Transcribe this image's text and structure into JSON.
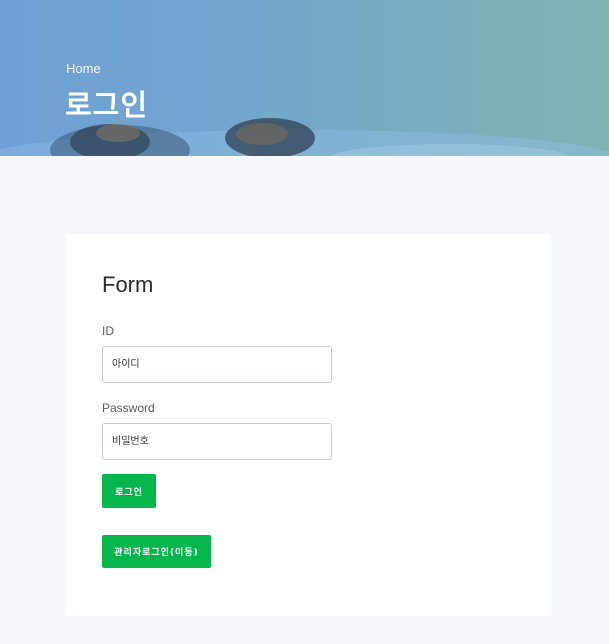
{
  "header": {
    "breadcrumb": "Home",
    "title": "로그인"
  },
  "form": {
    "title": "Form",
    "id_label": "ID",
    "id_placeholder": "아이디",
    "password_label": "Password",
    "password_placeholder": "비밀번호",
    "login_button": "로그인",
    "admin_login_button": "관리자로그인(이동)"
  },
  "colors": {
    "accent_button": "#05b64c",
    "page_background": "#f6f7fc",
    "hero_left": "#6f9fd6",
    "hero_right": "#7fb4b3"
  }
}
